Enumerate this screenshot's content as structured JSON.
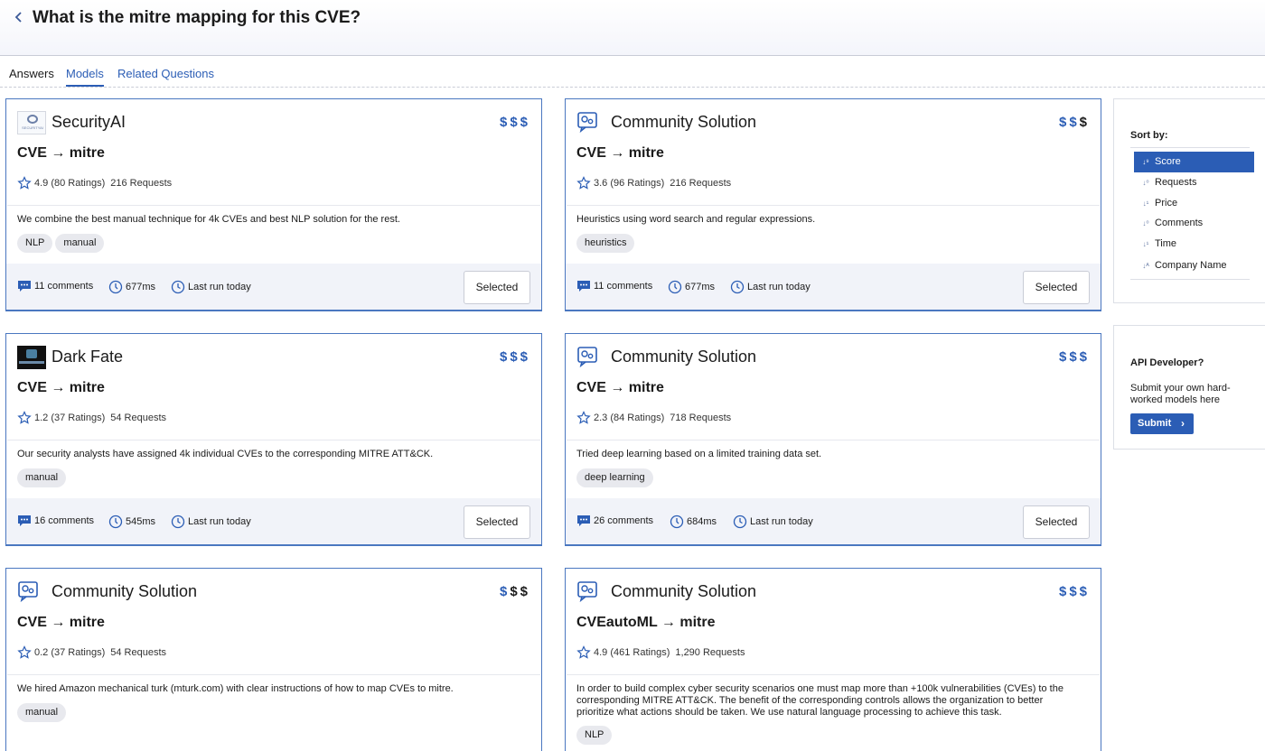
{
  "header": {
    "back_icon": "chevron-left-icon",
    "title": "What is the mitre mapping for this CVE?"
  },
  "tabs": [
    {
      "label": "Answers",
      "active": false
    },
    {
      "label": "Models",
      "active": true
    },
    {
      "label": "Related Questions",
      "active": false
    }
  ],
  "colors": {
    "accent": "#2b5db5",
    "card_border": "#4a77c0",
    "footer_bg": "#f1f3f9"
  },
  "models": [
    {
      "name": "SecurityAI",
      "logo": "securityai-logo",
      "price_level": 3,
      "mapping": "CVE → mitre",
      "rating": "4.9 (80 Ratings)",
      "requests": "216 Requests",
      "description": "We combine the best manual technique for 4k CVEs and best NLP solution for the rest.",
      "tags": [
        "NLP",
        "manual"
      ],
      "comments": "11 comments",
      "latency": "677ms",
      "last_run": "Last run today",
      "button": "Selected"
    },
    {
      "name": "Community Solution",
      "logo": "community-solution-icon",
      "price_level": 2,
      "mapping": "CVE → mitre",
      "rating": "3.6 (96 Ratings)",
      "requests": "216 Requests",
      "description": "Heuristics using word search and regular expressions.",
      "tags": [
        "heuristics"
      ],
      "comments": "11 comments",
      "latency": "677ms",
      "last_run": "Last run today",
      "button": "Selected"
    },
    {
      "name": "Dark Fate",
      "logo": "dark-fate-logo",
      "price_level": 3,
      "mapping": "CVE → mitre",
      "rating": "1.2 (37 Ratings)",
      "requests": "54 Requests",
      "description": "Our security analysts have assigned 4k individual CVEs to the corresponding MITRE ATT&CK.",
      "tags": [
        "manual"
      ],
      "comments": "16 comments",
      "latency": "545ms",
      "last_run": "Last run today",
      "button": "Selected"
    },
    {
      "name": "Community Solution",
      "logo": "community-solution-icon",
      "price_level": 3,
      "mapping": "CVE → mitre",
      "rating": "2.3 (84 Ratings)",
      "requests": "718 Requests",
      "description": "Tried deep learning based on a limited training data set.",
      "tags": [
        "deep learning"
      ],
      "comments": "26 comments",
      "latency": "684ms",
      "last_run": "Last run today",
      "button": "Selected"
    },
    {
      "name": "Community Solution",
      "logo": "community-solution-icon",
      "price_level": 1,
      "mapping": "CVE → mitre",
      "rating": "0.2 (37 Ratings)",
      "requests": "54 Requests",
      "description": "We hired Amazon mechanical turk (mturk.com) with clear instructions of how to map CVEs to mitre.",
      "tags": [
        "manual"
      ]
    },
    {
      "name": "Community Solution",
      "logo": "community-solution-icon",
      "price_level": 3,
      "mapping": "CVEautoML → mitre",
      "rating": "4.9 (461 Ratings)",
      "requests": "1,290 Requests",
      "description": "In order to build complex cyber security scenarios one must map more than +100k vulnerabilities (CVEs) to the corresponding MITRE ATT&CK. The benefit of the corresponding controls allows the organization to better prioritize what actions should be taken. We use natural language processing to achieve this task.",
      "tags": [
        "NLP"
      ]
    }
  ],
  "sort": {
    "title": "Sort by:",
    "options": [
      {
        "label": "Score",
        "icon": "sort-desc-icon",
        "active": true
      },
      {
        "label": "Requests",
        "icon": "sort-numeric-icon",
        "active": false
      },
      {
        "label": "Price",
        "icon": "sort-numeric-icon",
        "active": false
      },
      {
        "label": "Comments",
        "icon": "sort-numeric-icon",
        "active": false
      },
      {
        "label": "Time",
        "icon": "sort-numeric-icon",
        "active": false
      },
      {
        "label": "Company Name",
        "icon": "sort-alpha-icon",
        "active": false
      }
    ]
  },
  "api": {
    "title": "API Developer?",
    "text": "Submit your own hard-worked models here",
    "button": "Submit"
  }
}
